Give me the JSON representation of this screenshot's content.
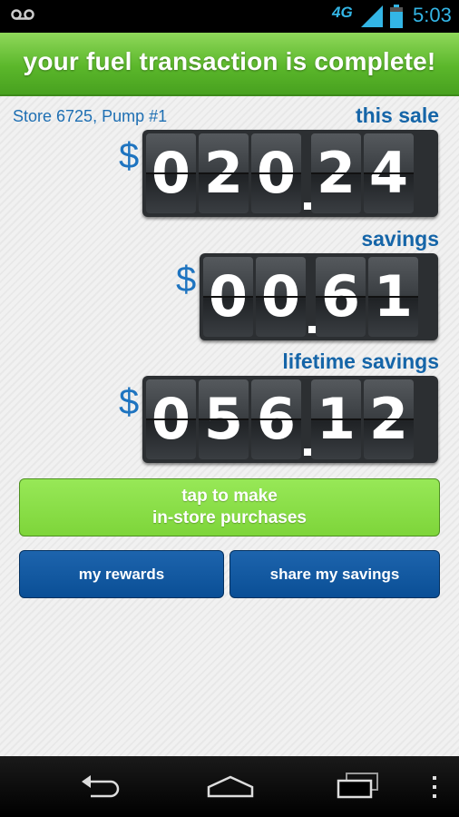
{
  "status_bar": {
    "network": "4G",
    "time": "5:03",
    "icons": [
      "voicemail-icon",
      "signal-icon",
      "battery-icon"
    ],
    "accent_color": "#33b5e5"
  },
  "header": {
    "title": "your fuel transaction is complete!",
    "color": "#5bb72b"
  },
  "transaction": {
    "store": "Store 6725, Pump #1",
    "this_sale": {
      "label": "this sale",
      "currency": "$",
      "digits": [
        "0",
        "2",
        "0",
        "2",
        "4"
      ],
      "value": "020.24"
    },
    "savings": {
      "label": "savings",
      "currency": "$",
      "digits": [
        "0",
        "0",
        "6",
        "1"
      ],
      "value": "00.61"
    },
    "lifetime_savings": {
      "label": "lifetime savings",
      "currency": "$",
      "digits": [
        "0",
        "5",
        "6",
        "1",
        "2"
      ],
      "value": "056.12"
    }
  },
  "buttons": {
    "instore_line1": "tap to make",
    "instore_line2": "in-store purchases",
    "rewards": "my rewards",
    "share": "share my savings"
  },
  "nav_bar": {
    "icons": [
      "back-icon",
      "home-icon",
      "recent-apps-icon",
      "menu-icon"
    ]
  }
}
